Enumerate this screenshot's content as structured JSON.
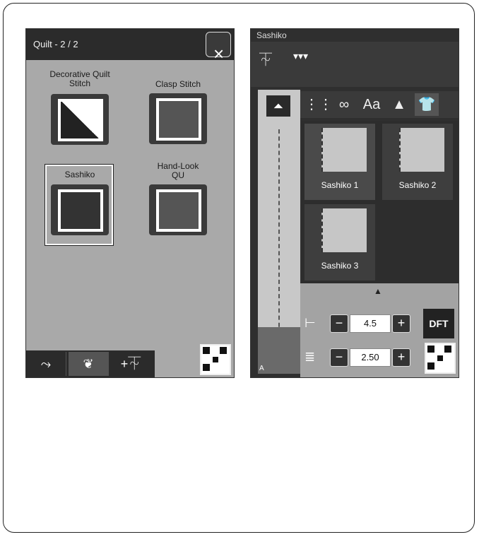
{
  "left": {
    "title": "Quilt - 2 / 2",
    "close_icon": "×",
    "items": [
      {
        "label": "Decorative Quilt Stitch"
      },
      {
        "label": "Clasp Stitch"
      },
      {
        "label": "Sashiko"
      },
      {
        "label": "Hand-Look QU"
      }
    ],
    "toolbar": {
      "btn1_glyph": "⤳",
      "btn2_glyph": "❦",
      "btn3_glyph": "+⏇"
    }
  },
  "right": {
    "title": "Sashiko",
    "tabs": [
      "⋮⋮",
      "∞",
      "Aa",
      "▲",
      "👕"
    ],
    "stitches": [
      {
        "label": "Sashiko 1"
      },
      {
        "label": "Sashiko 2"
      },
      {
        "label": "Sashiko 3"
      }
    ],
    "width_value": "4.5",
    "length_value": "2.50",
    "minus": "−",
    "plus": "+",
    "dft_label": "DFT",
    "foot_label": "A"
  }
}
